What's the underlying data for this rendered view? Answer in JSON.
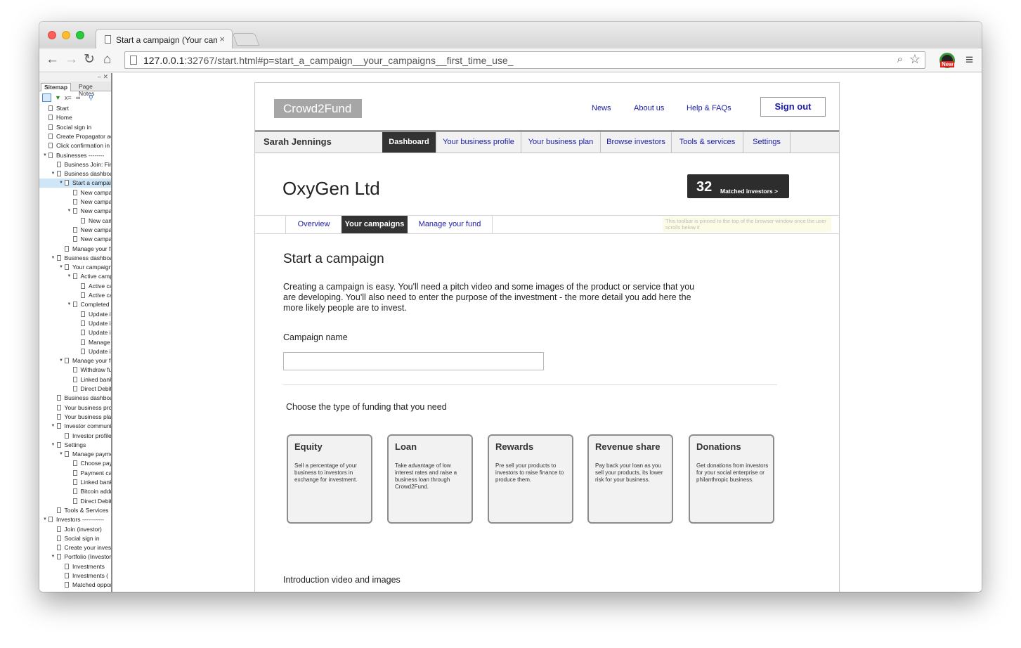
{
  "browser": {
    "tab_title": "Start a campaign (Your campaigns",
    "tab_close": "×",
    "url_host": "127.0.0.1",
    "url_rest": ":32767/start.html#p=start_a_campaign__your_campaigns__first_time_use_",
    "ext_badge": "New"
  },
  "sidebar": {
    "controls": "‒ ✕",
    "tabs": [
      "Sitemap",
      "Page Notes"
    ],
    "tools": [
      "x=",
      "∞"
    ],
    "items": [
      {
        "label": "Start",
        "depth": 0,
        "caret": false,
        "selected": false
      },
      {
        "label": "Home",
        "depth": 0,
        "caret": false,
        "selected": false
      },
      {
        "label": "Social sign in",
        "depth": 0,
        "caret": false,
        "selected": false
      },
      {
        "label": "Create Propagator account",
        "depth": 0,
        "caret": false,
        "selected": false
      },
      {
        "label": "Click confirmation in email",
        "depth": 0,
        "caret": false,
        "selected": false
      },
      {
        "label": "Businesses --------",
        "depth": 0,
        "caret": true,
        "selected": false
      },
      {
        "label": "Business Join: First",
        "depth": 1,
        "caret": false,
        "selected": false
      },
      {
        "label": "Business dashboard",
        "depth": 1,
        "caret": true,
        "selected": false
      },
      {
        "label": "Start a campaign",
        "depth": 2,
        "caret": true,
        "selected": true
      },
      {
        "label": "New campaign",
        "depth": 3,
        "caret": false,
        "selected": false
      },
      {
        "label": "New campaign",
        "depth": 3,
        "caret": false,
        "selected": false
      },
      {
        "label": "New campaign",
        "depth": 3,
        "caret": true,
        "selected": false
      },
      {
        "label": "New campaign",
        "depth": 4,
        "caret": false,
        "selected": false
      },
      {
        "label": "New campaign",
        "depth": 3,
        "caret": false,
        "selected": false
      },
      {
        "label": "New campaign",
        "depth": 3,
        "caret": false,
        "selected": false
      },
      {
        "label": "Manage your fund",
        "depth": 2,
        "caret": false,
        "selected": false
      },
      {
        "label": "Business dashboard",
        "depth": 1,
        "caret": true,
        "selected": false
      },
      {
        "label": "Your campaigns",
        "depth": 2,
        "caret": true,
        "selected": false
      },
      {
        "label": "Active campaigns",
        "depth": 3,
        "caret": true,
        "selected": false
      },
      {
        "label": "Active campaign",
        "depth": 4,
        "caret": false,
        "selected": false
      },
      {
        "label": "Active campaign",
        "depth": 4,
        "caret": false,
        "selected": false
      },
      {
        "label": "Completed",
        "depth": 3,
        "caret": true,
        "selected": false
      },
      {
        "label": "Update investors",
        "depth": 4,
        "caret": false,
        "selected": false
      },
      {
        "label": "Update investors",
        "depth": 4,
        "caret": false,
        "selected": false
      },
      {
        "label": "Update investors",
        "depth": 4,
        "caret": false,
        "selected": false
      },
      {
        "label": "Manage",
        "depth": 4,
        "caret": false,
        "selected": false
      },
      {
        "label": "Update investors",
        "depth": 4,
        "caret": false,
        "selected": false
      },
      {
        "label": "Manage your fund",
        "depth": 2,
        "caret": true,
        "selected": false
      },
      {
        "label": "Withdraw funds",
        "depth": 3,
        "caret": false,
        "selected": false
      },
      {
        "label": "Linked bank",
        "depth": 3,
        "caret": false,
        "selected": false
      },
      {
        "label": "Direct Debit",
        "depth": 3,
        "caret": false,
        "selected": false
      },
      {
        "label": "Business dashboard",
        "depth": 1,
        "caret": false,
        "selected": false
      },
      {
        "label": "Your business profile",
        "depth": 1,
        "caret": false,
        "selected": false
      },
      {
        "label": "Your business plan",
        "depth": 1,
        "caret": false,
        "selected": false
      },
      {
        "label": "Investor community",
        "depth": 1,
        "caret": true,
        "selected": false
      },
      {
        "label": "Investor profile",
        "depth": 2,
        "caret": false,
        "selected": false
      },
      {
        "label": "Settings",
        "depth": 1,
        "caret": true,
        "selected": false
      },
      {
        "label": "Manage payments",
        "depth": 2,
        "caret": true,
        "selected": false
      },
      {
        "label": "Choose payment",
        "depth": 3,
        "caret": false,
        "selected": false
      },
      {
        "label": "Payment card",
        "depth": 3,
        "caret": false,
        "selected": false
      },
      {
        "label": "Linked bank",
        "depth": 3,
        "caret": false,
        "selected": false
      },
      {
        "label": "Bitcoin address",
        "depth": 3,
        "caret": false,
        "selected": false
      },
      {
        "label": "Direct Debit",
        "depth": 3,
        "caret": false,
        "selected": false
      },
      {
        "label": "Tools & Services",
        "depth": 1,
        "caret": false,
        "selected": false
      },
      {
        "label": "Investors -----------",
        "depth": 0,
        "caret": true,
        "selected": false
      },
      {
        "label": "Join (investor)",
        "depth": 1,
        "caret": false,
        "selected": false
      },
      {
        "label": "Social sign in",
        "depth": 1,
        "caret": false,
        "selected": false
      },
      {
        "label": "Create your investor",
        "depth": 1,
        "caret": false,
        "selected": false
      },
      {
        "label": "Portfolio (Investor)",
        "depth": 1,
        "caret": true,
        "selected": false
      },
      {
        "label": "Investments",
        "depth": 2,
        "caret": false,
        "selected": false
      },
      {
        "label": "Investments (",
        "depth": 2,
        "caret": false,
        "selected": false
      },
      {
        "label": "Matched opportunities",
        "depth": 2,
        "caret": false,
        "selected": false
      }
    ]
  },
  "site": {
    "logo": "Crowd2Fund",
    "top_links": [
      "News",
      "About us",
      "Help & FAQs"
    ],
    "sign_out": "Sign out",
    "user_name": "Sarah Jennings",
    "main_nav": [
      "Dashboard",
      "Your business profile",
      "Your business plan",
      "Browse investors",
      "Tools & services",
      "Settings"
    ],
    "company_name": "OxyGen Ltd",
    "matched_count": "32",
    "matched_label": "Matched investors  >",
    "sub_nav": [
      "Overview",
      "Your campaigns",
      "Manage your fund"
    ],
    "pin_note": "This toolbar is pinned to the top of the browser window once the user scrolls below it",
    "heading": "Start a campaign",
    "intro": "Creating a campaign is easy. You'll need a pitch video and some images of the product or service that you are developing. You'll also need to enter the purpose of the investment - the more detail you add here the more likely people are to invest.",
    "campaign_name_label": "Campaign name",
    "campaign_name_value": "",
    "funding_label": "Choose the type of funding that you need",
    "funding_types": [
      {
        "title": "Equity",
        "desc": "Sell a percentage of your business to investors in exchange for investment."
      },
      {
        "title": "Loan",
        "desc": "Take advantage of low interest rates and raise a business loan through Crowd2Fund."
      },
      {
        "title": "Rewards",
        "desc": "Pre sell your products to investors to raise finance to produce them."
      },
      {
        "title": "Revenue share",
        "desc": "Pay back your loan as you sell your products, its lower risk for your business."
      },
      {
        "title": "Donations",
        "desc": "Get donations from investors for your social enterprise or philanthropic business."
      }
    ],
    "video_label": "Introduction video and images"
  }
}
